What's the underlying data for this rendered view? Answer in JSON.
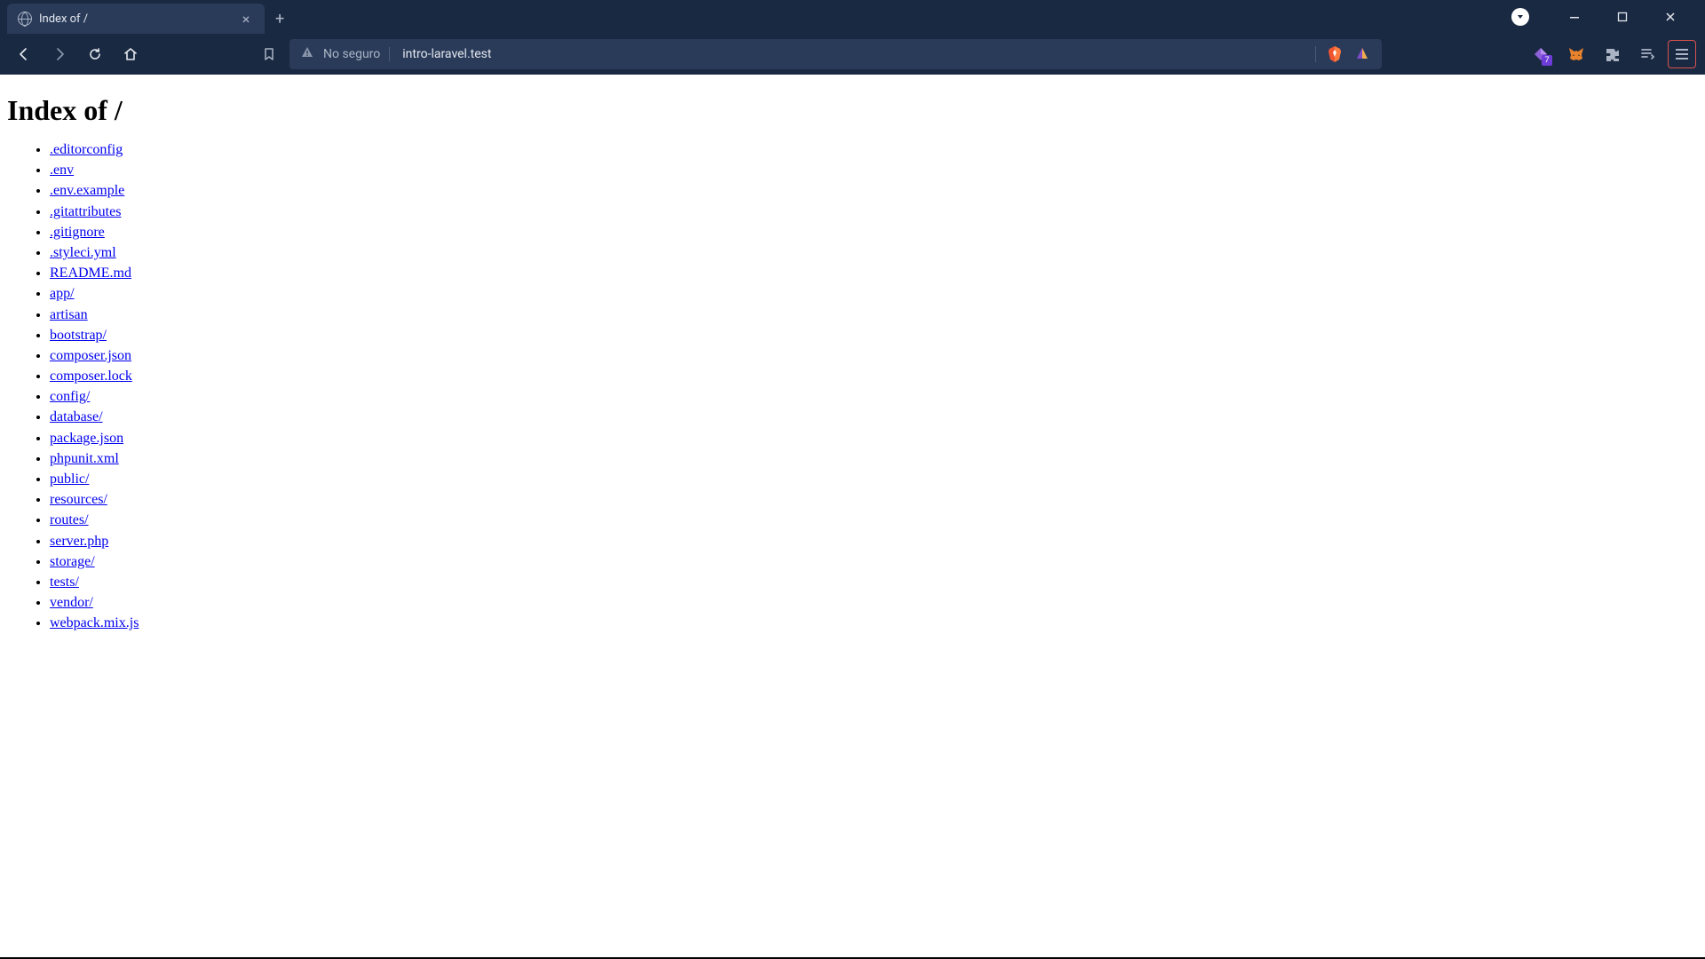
{
  "browser": {
    "tab": {
      "title": "Index of /"
    },
    "address": {
      "insecure_label": "No seguro",
      "url": "intro-laravel.test"
    },
    "extension_badge": "7"
  },
  "page": {
    "heading": "Index of /",
    "files": [
      ".editorconfig",
      ".env",
      ".env.example",
      ".gitattributes",
      ".gitignore",
      ".styleci.yml",
      "README.md",
      "app/",
      "artisan",
      "bootstrap/",
      "composer.json",
      "composer.lock",
      "config/",
      "database/",
      "package.json",
      "phpunit.xml",
      "public/",
      "resources/",
      "routes/",
      "server.php",
      "storage/",
      "tests/",
      "vendor/",
      "webpack.mix.js"
    ]
  }
}
